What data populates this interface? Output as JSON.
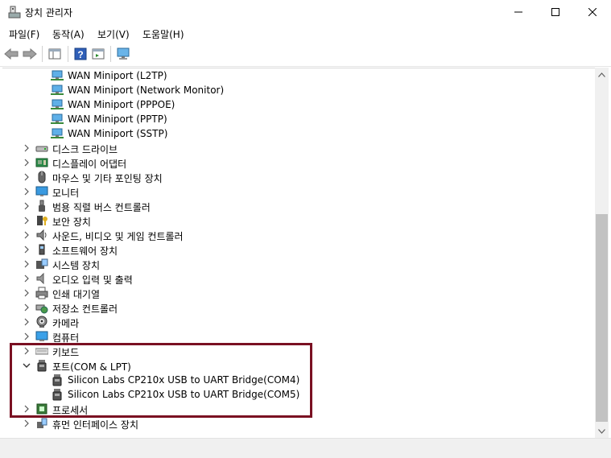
{
  "window": {
    "title": "장치 관리자"
  },
  "menu": [
    {
      "label": "파일(F)"
    },
    {
      "label": "동작(A)"
    },
    {
      "label": "보기(V)"
    },
    {
      "label": "도움말(H)"
    }
  ],
  "colors": {
    "highlight": "#7a1022",
    "monitor_blue": "#2a8ad4"
  },
  "tree": [
    {
      "label": "WAN Miniport (L2TP)",
      "icon": "network-adapter-icon",
      "level": 2,
      "arrow": "none"
    },
    {
      "label": "WAN Miniport (Network Monitor)",
      "icon": "network-adapter-icon",
      "level": 2,
      "arrow": "none"
    },
    {
      "label": "WAN Miniport (PPPOE)",
      "icon": "network-adapter-icon",
      "level": 2,
      "arrow": "none"
    },
    {
      "label": "WAN Miniport (PPTP)",
      "icon": "network-adapter-icon",
      "level": 2,
      "arrow": "none"
    },
    {
      "label": "WAN Miniport (SSTP)",
      "icon": "network-adapter-icon",
      "level": 2,
      "arrow": "none"
    },
    {
      "label": "디스크 드라이브",
      "icon": "disk-drive-icon",
      "level": 1,
      "arrow": "collapsed"
    },
    {
      "label": "디스플레이 어댑터",
      "icon": "display-adapter-icon",
      "level": 1,
      "arrow": "collapsed"
    },
    {
      "label": "마우스 및 기타 포인팅 장치",
      "icon": "mouse-icon",
      "level": 1,
      "arrow": "collapsed"
    },
    {
      "label": "모니터",
      "icon": "monitor-icon",
      "level": 1,
      "arrow": "collapsed"
    },
    {
      "label": "범용 직렬 버스 컨트롤러",
      "icon": "usb-icon",
      "level": 1,
      "arrow": "collapsed"
    },
    {
      "label": "보안 장치",
      "icon": "security-key-icon",
      "level": 1,
      "arrow": "collapsed"
    },
    {
      "label": "사운드, 비디오 및 게임 컨트롤러",
      "icon": "speaker-icon",
      "level": 1,
      "arrow": "collapsed"
    },
    {
      "label": "소프트웨어 장치",
      "icon": "software-device-icon",
      "level": 1,
      "arrow": "collapsed"
    },
    {
      "label": "시스템 장치",
      "icon": "system-device-icon",
      "level": 1,
      "arrow": "collapsed"
    },
    {
      "label": "오디오 입력 및 출력",
      "icon": "audio-io-icon",
      "level": 1,
      "arrow": "collapsed"
    },
    {
      "label": "인쇄 대기열",
      "icon": "printer-icon",
      "level": 1,
      "arrow": "collapsed"
    },
    {
      "label": "저장소 컨트롤러",
      "icon": "storage-controller-icon",
      "level": 1,
      "arrow": "collapsed"
    },
    {
      "label": "카메라",
      "icon": "camera-icon",
      "level": 1,
      "arrow": "collapsed"
    },
    {
      "label": "컴퓨터",
      "icon": "computer-icon",
      "level": 1,
      "arrow": "collapsed"
    },
    {
      "label": "키보드",
      "icon": "keyboard-icon",
      "level": 1,
      "arrow": "collapsed"
    },
    {
      "label": "포트(COM & LPT)",
      "icon": "port-icon",
      "level": 1,
      "arrow": "expanded"
    },
    {
      "label": "Silicon Labs CP210x USB to UART Bridge(COM4)",
      "icon": "port-icon",
      "level": 2,
      "arrow": "none"
    },
    {
      "label": "Silicon Labs CP210x USB to UART Bridge(COM5)",
      "icon": "port-icon",
      "level": 2,
      "arrow": "none"
    },
    {
      "label": "프로세서",
      "icon": "processor-icon",
      "level": 1,
      "arrow": "collapsed"
    },
    {
      "label": "휴먼 인터페이스 장치",
      "icon": "hid-icon",
      "level": 1,
      "arrow": "collapsed"
    }
  ]
}
